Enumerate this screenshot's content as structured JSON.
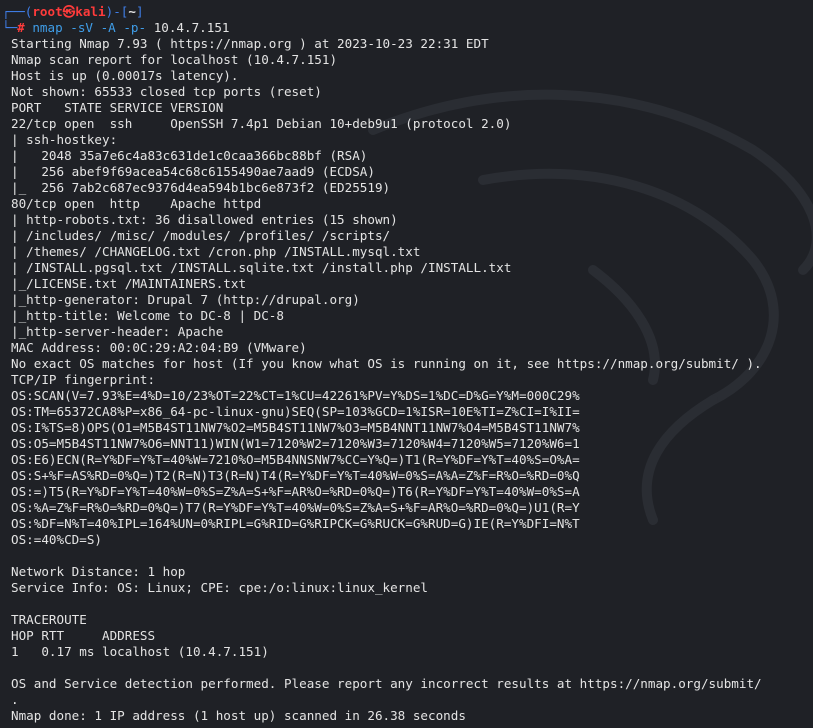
{
  "prompt": {
    "frame_top": "┌──(",
    "user_host": "root㉿kali",
    "sep": ")-[",
    "dir": "~",
    "close": "]",
    "frame_bottom": "└─",
    "hash": "# ",
    "cmd_name": "nmap",
    "cmd_args": " -sV -A -p- ",
    "cmd_target": "10.4.7.151"
  },
  "colors": {
    "background": "#1f2126",
    "text": "#e4e4e4",
    "prompt_frame": "#3f7ee8",
    "prompt_user": "#ff3b3b",
    "command": "#3f9de8"
  },
  "output": [
    "Starting Nmap 7.93 ( https://nmap.org ) at 2023-10-23 22:31 EDT",
    "Nmap scan report for localhost (10.4.7.151)",
    "Host is up (0.00017s latency).",
    "Not shown: 65533 closed tcp ports (reset)",
    "PORT   STATE SERVICE VERSION",
    "22/tcp open  ssh     OpenSSH 7.4p1 Debian 10+deb9u1 (protocol 2.0)",
    "| ssh-hostkey: ",
    "|   2048 35a7e6c4a83c631de1c0caa366bc88bf (RSA)",
    "|   256 abef9f69acea54c68c6155490ae7aad9 (ECDSA)",
    "|_  256 7ab2c687ec9376d4ea594b1bc6e873f2 (ED25519)",
    "80/tcp open  http    Apache httpd",
    "| http-robots.txt: 36 disallowed entries (15 shown)",
    "| /includes/ /misc/ /modules/ /profiles/ /scripts/ ",
    "| /themes/ /CHANGELOG.txt /cron.php /INSTALL.mysql.txt ",
    "| /INSTALL.pgsql.txt /INSTALL.sqlite.txt /install.php /INSTALL.txt ",
    "|_/LICENSE.txt /MAINTAINERS.txt",
    "|_http-generator: Drupal 7 (http://drupal.org)",
    "|_http-title: Welcome to DC-8 | DC-8",
    "|_http-server-header: Apache",
    "MAC Address: 00:0C:29:A2:04:B9 (VMware)",
    "No exact OS matches for host (If you know what OS is running on it, see https://nmap.org/submit/ ).",
    "TCP/IP fingerprint:",
    "OS:SCAN(V=7.93%E=4%D=10/23%OT=22%CT=1%CU=42261%PV=Y%DS=1%DC=D%G=Y%M=000C29%",
    "OS:TM=65372CA8%P=x86_64-pc-linux-gnu)SEQ(SP=103%GCD=1%ISR=10E%TI=Z%CI=I%II=",
    "OS:I%TS=8)OPS(O1=M5B4ST11NW7%O2=M5B4ST11NW7%O3=M5B4NNT11NW7%O4=M5B4ST11NW7%",
    "OS:O5=M5B4ST11NW7%O6=NNT11)WIN(W1=7120%W2=7120%W3=7120%W4=7120%W5=7120%W6=1",
    "OS:E6)ECN(R=Y%DF=Y%T=40%W=7210%O=M5B4NNSNW7%CC=Y%Q=)T1(R=Y%DF=Y%T=40%S=O%A=",
    "OS:S+%F=AS%RD=0%Q=)T2(R=N)T3(R=N)T4(R=Y%DF=Y%T=40%W=0%S=A%A=Z%F=R%O=%RD=0%Q",
    "OS:=)T5(R=Y%DF=Y%T=40%W=0%S=Z%A=S+%F=AR%O=%RD=0%Q=)T6(R=Y%DF=Y%T=40%W=0%S=A",
    "OS:%A=Z%F=R%O=%RD=0%Q=)T7(R=Y%DF=Y%T=40%W=0%S=Z%A=S+%F=AR%O=%RD=0%Q=)U1(R=Y",
    "OS:%DF=N%T=40%IPL=164%UN=0%RIPL=G%RID=G%RIPCK=G%RUCK=G%RUD=G)IE(R=Y%DFI=N%T",
    "OS:=40%CD=S)",
    "",
    "Network Distance: 1 hop",
    "Service Info: OS: Linux; CPE: cpe:/o:linux:linux_kernel",
    "",
    "TRACEROUTE",
    "HOP RTT     ADDRESS",
    "1   0.17 ms localhost (10.4.7.151)",
    "",
    "OS and Service detection performed. Please report any incorrect results at https://nmap.org/submit/",
    ".",
    "Nmap done: 1 IP address (1 host up) scanned in 26.38 seconds"
  ]
}
